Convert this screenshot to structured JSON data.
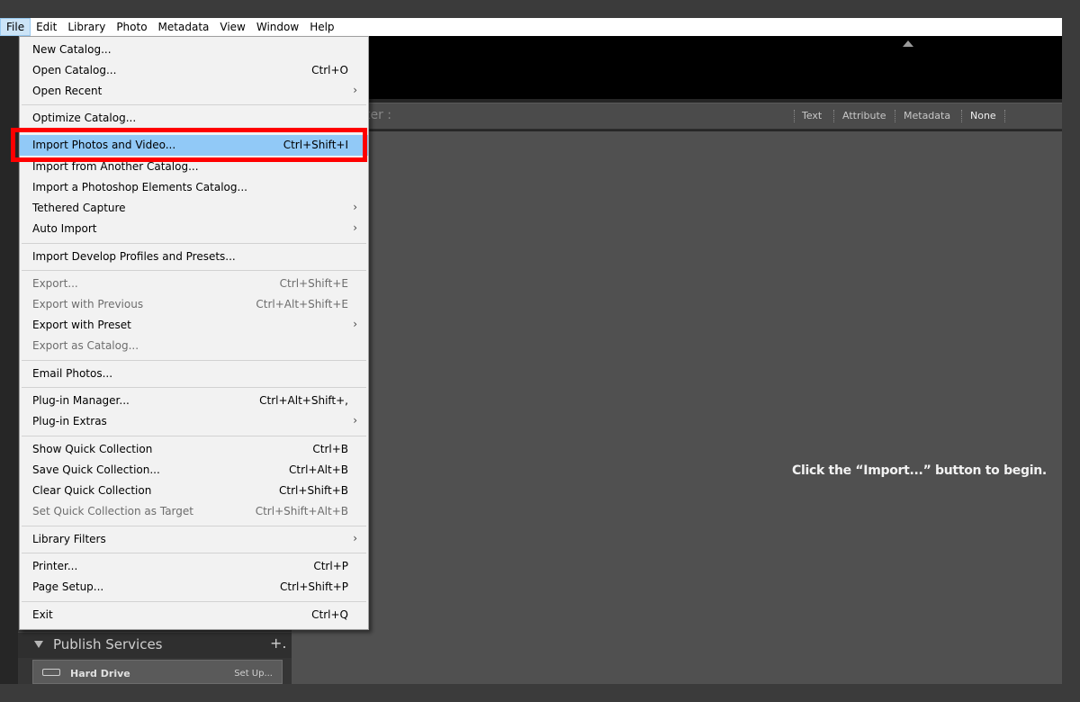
{
  "menubar": {
    "items": [
      "File",
      "Edit",
      "Library",
      "Photo",
      "Metadata",
      "View",
      "Window",
      "Help"
    ]
  },
  "filterbar": {
    "label": "ter :",
    "options": [
      "Text",
      "Attribute",
      "Metadata",
      "None"
    ]
  },
  "grid": {
    "message": "Click the “Import...” button to begin."
  },
  "left_panel": {
    "publish_title": "Publish Services",
    "publish_add": "+.",
    "hard_drive_label": "Hard Drive",
    "hard_drive_action": "Set Up..."
  },
  "file_menu": {
    "items": [
      {
        "label": "New Catalog...",
        "shortcut": ""
      },
      {
        "label": "Open Catalog...",
        "shortcut": "Ctrl+O"
      },
      {
        "label": "Open Recent",
        "shortcut": "",
        "submenu": "›"
      },
      {
        "label": "Optimize Catalog...",
        "shortcut": ""
      },
      {
        "label": "Import Photos and Video...",
        "shortcut": "Ctrl+Shift+I"
      },
      {
        "label": "Import from Another Catalog...",
        "shortcut": ""
      },
      {
        "label": "Import a Photoshop Elements Catalog...",
        "shortcut": ""
      },
      {
        "label": "Tethered Capture",
        "shortcut": "",
        "submenu": "›"
      },
      {
        "label": "Auto Import",
        "shortcut": "",
        "submenu": "›"
      },
      {
        "label": "Import Develop Profiles and Presets...",
        "shortcut": ""
      },
      {
        "label": "Export...",
        "shortcut": "Ctrl+Shift+E"
      },
      {
        "label": "Export with Previous",
        "shortcut": "Ctrl+Alt+Shift+E"
      },
      {
        "label": "Export with Preset",
        "shortcut": "",
        "submenu": "›"
      },
      {
        "label": "Export as Catalog...",
        "shortcut": ""
      },
      {
        "label": "Email Photos...",
        "shortcut": ""
      },
      {
        "label": "Plug-in Manager...",
        "shortcut": "Ctrl+Alt+Shift+,"
      },
      {
        "label": "Plug-in Extras",
        "shortcut": "",
        "submenu": "›"
      },
      {
        "label": "Show Quick Collection",
        "shortcut": "Ctrl+B"
      },
      {
        "label": "Save Quick Collection...",
        "shortcut": "Ctrl+Alt+B"
      },
      {
        "label": "Clear Quick Collection",
        "shortcut": "Ctrl+Shift+B"
      },
      {
        "label": "Set Quick Collection as Target",
        "shortcut": "Ctrl+Shift+Alt+B"
      },
      {
        "label": "Library Filters",
        "shortcut": "",
        "submenu": "›"
      },
      {
        "label": "Printer...",
        "shortcut": "Ctrl+P"
      },
      {
        "label": "Page Setup...",
        "shortcut": "Ctrl+Shift+P"
      },
      {
        "label": "Exit",
        "shortcut": "Ctrl+Q"
      }
    ]
  },
  "colors": {
    "highlight_box": "#ff0000",
    "menu_hover": "#91c9f7"
  }
}
